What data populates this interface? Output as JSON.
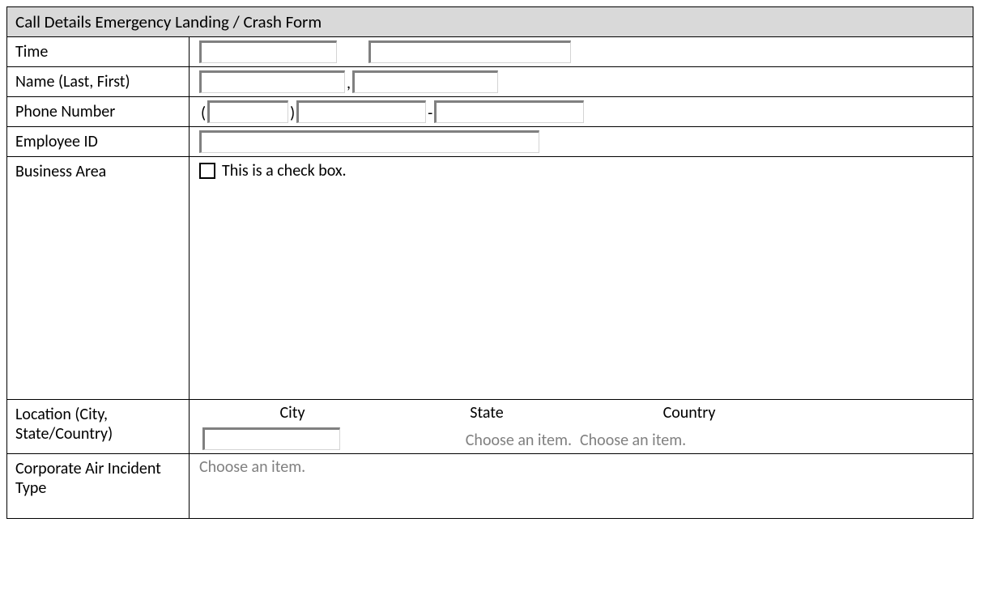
{
  "form": {
    "title": "Call Details Emergency Landing / Crash Form",
    "rows": {
      "time": {
        "label": "Time"
      },
      "name": {
        "label": "Name (Last, First)",
        "separator": ","
      },
      "phone": {
        "label": "Phone Number",
        "paren_open": "(",
        "paren_close": ")",
        "dash": "-"
      },
      "employee_id": {
        "label": "Employee ID"
      },
      "business_area": {
        "label": "Business Area",
        "checkbox_label": "This is a check box."
      },
      "location": {
        "label": "Location (City, State/Country)",
        "headers": {
          "city": "City",
          "state": "State",
          "country": "Country"
        },
        "state_placeholder": "Choose an item.",
        "country_placeholder": "Choose an item."
      },
      "incident_type": {
        "label": "Corporate Air Incident Type",
        "placeholder": "Choose an item."
      }
    }
  }
}
